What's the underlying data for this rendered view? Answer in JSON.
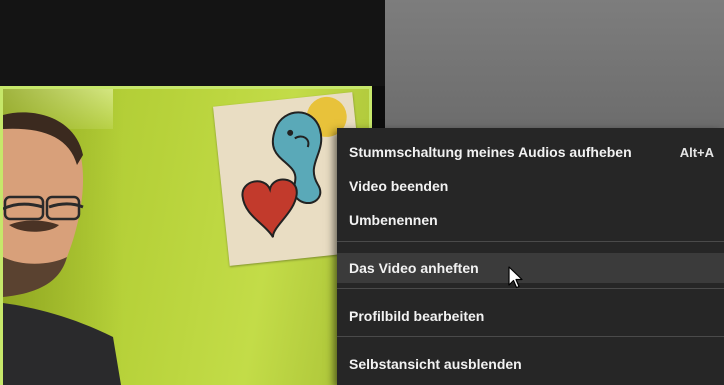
{
  "context_menu": {
    "items": [
      {
        "label": "Stummschaltung meines Audios aufheben",
        "shortcut": "Alt+A"
      },
      {
        "label": "Video beenden"
      },
      {
        "label": "Umbenennen"
      },
      {
        "label": "Das Video anheften"
      },
      {
        "label": "Profilbild bearbeiten"
      },
      {
        "label": "Selbstansicht ausblenden"
      }
    ],
    "hovered_item": "Das Video anheften"
  },
  "icons": {
    "cursor": "mouse-pointer-icon"
  },
  "colors": {
    "menu_background": "#262626",
    "menu_hover": "#3b3b3b",
    "active_speaker_border": "#c6e76a"
  }
}
